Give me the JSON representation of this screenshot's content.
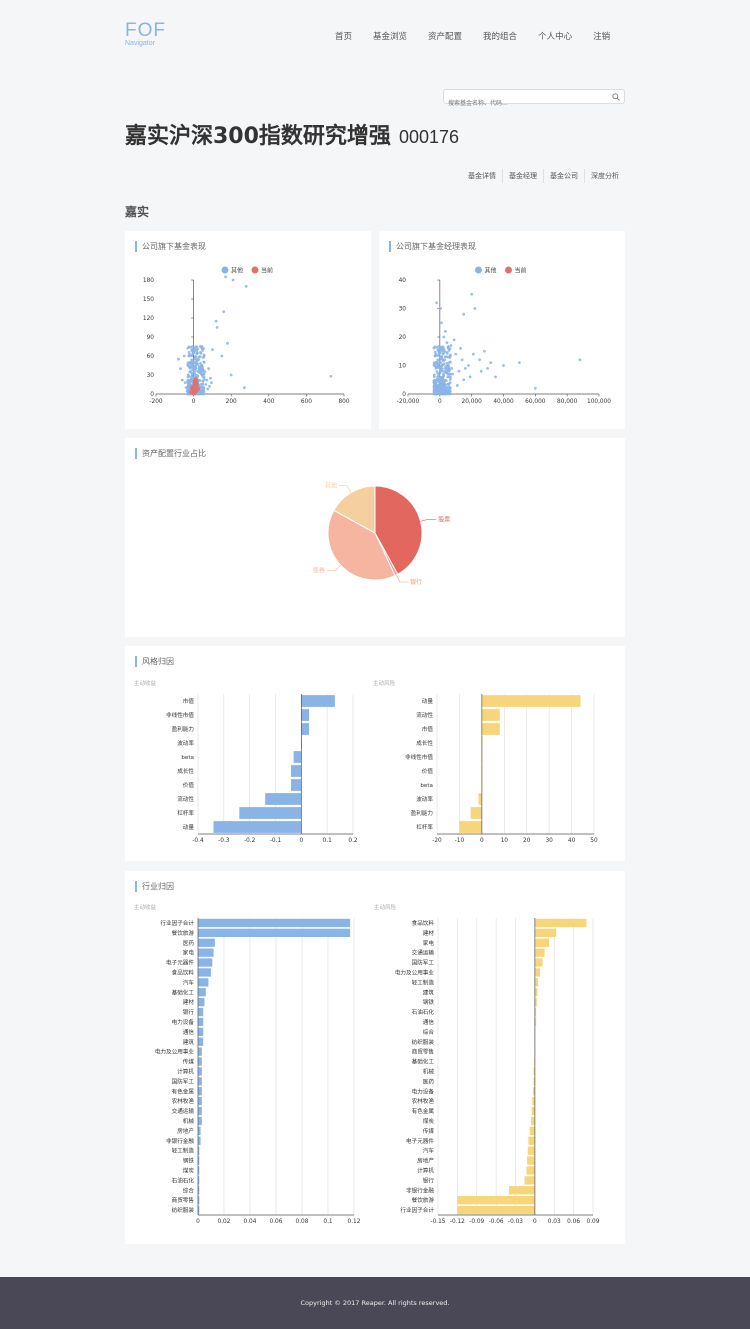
{
  "header": {
    "logo": "FOF",
    "logo_sub": "Navigator",
    "nav": [
      "首页",
      "基金浏览",
      "资产配置",
      "我的组合",
      "个人中心",
      "注销"
    ]
  },
  "search": {
    "placeholder": "搜索基金名称、代码..."
  },
  "fund": {
    "name": "嘉实沪深300指数研究增强",
    "code": "000176"
  },
  "subtabs": [
    "基金详情",
    "基金经理",
    "基金公司",
    "深度分析"
  ],
  "company": "嘉实",
  "cards": {
    "fund_perf": "公司旗下基金表现",
    "manager_perf": "公司旗下基金经理表现",
    "allocation": "资产配置行业占比",
    "style": "风格归因",
    "industry": "行业归因"
  },
  "legend": {
    "other": "其他",
    "current": "当前"
  },
  "sub_labels": {
    "income": "主动收益",
    "risk": "主动风险"
  },
  "colors": {
    "blue": "#8ab4e6",
    "red": "#e0716a",
    "yellow": "#f7d57a",
    "pie_stock": "#e2685f",
    "pie_bond": "#f5b5a1",
    "pie_other": "#f5cfa0",
    "pie_bank": "#ef9a84"
  },
  "chart_data": [
    {
      "type": "scatter",
      "title": "公司旗下基金表现",
      "xlim": [
        -200,
        800
      ],
      "ylim": [
        0,
        180
      ],
      "xticks": [
        -200,
        0,
        200,
        400,
        600,
        800
      ],
      "yticks": [
        0,
        30,
        60,
        90,
        120,
        150,
        180
      ],
      "series": [
        {
          "name": "其他",
          "points": [
            [
              -10,
              20
            ],
            [
              -5,
              15
            ],
            [
              0,
              10
            ],
            [
              5,
              25
            ],
            [
              10,
              30
            ],
            [
              15,
              20
            ],
            [
              20,
              18
            ],
            [
              -20,
              35
            ],
            [
              -25,
              28
            ],
            [
              30,
              12
            ],
            [
              40,
              40
            ],
            [
              -30,
              45
            ],
            [
              -15,
              50
            ],
            [
              25,
              55
            ],
            [
              60,
              35
            ],
            [
              80,
              40
            ],
            [
              100,
              70
            ],
            [
              120,
              115
            ],
            [
              125,
              105
            ],
            [
              160,
              130
            ],
            [
              170,
              185
            ],
            [
              210,
              180
            ],
            [
              280,
              170
            ],
            [
              200,
              30
            ],
            [
              270,
              10
            ],
            [
              730,
              28
            ],
            [
              150,
              60
            ],
            [
              180,
              80
            ],
            [
              -50,
              60
            ],
            [
              -70,
              40
            ],
            [
              -80,
              55
            ],
            [
              50,
              20
            ],
            [
              70,
              22
            ],
            [
              90,
              25
            ],
            [
              -40,
              10
            ],
            [
              -35,
              5
            ],
            [
              10,
              50
            ],
            [
              20,
              65
            ],
            [
              35,
              75
            ],
            [
              -5,
              38
            ],
            [
              0,
              45
            ],
            [
              5,
              33
            ],
            [
              12,
              42
            ],
            [
              18,
              48
            ],
            [
              22,
              28
            ],
            [
              -8,
              26
            ],
            [
              45,
              30
            ],
            [
              55,
              50
            ],
            [
              65,
              15
            ],
            [
              75,
              8
            ],
            [
              85,
              12
            ],
            [
              95,
              18
            ],
            [
              -60,
              22
            ],
            [
              -45,
              18
            ]
          ]
        },
        {
          "name": "当前",
          "points": [
            [
              0,
              8
            ],
            [
              5,
              12
            ],
            [
              10,
              5
            ],
            [
              -5,
              10
            ],
            [
              15,
              15
            ],
            [
              8,
              18
            ],
            [
              -10,
              3
            ],
            [
              20,
              8
            ],
            [
              3,
              2
            ],
            [
              12,
              22
            ]
          ]
        }
      ]
    },
    {
      "type": "scatter",
      "title": "公司旗下基金经理表现",
      "xlim": [
        -20000,
        100000
      ],
      "ylim": [
        0,
        40
      ],
      "xticks": [
        -20000,
        0,
        20000,
        40000,
        60000,
        80000,
        100000
      ],
      "yticks": [
        0,
        10,
        20,
        30,
        40
      ],
      "series": [
        {
          "name": "其他",
          "points": [
            [
              500,
              5
            ],
            [
              1000,
              8
            ],
            [
              2000,
              12
            ],
            [
              3000,
              15
            ],
            [
              1500,
              10
            ],
            [
              4000,
              9
            ],
            [
              5000,
              6
            ],
            [
              6000,
              11
            ],
            [
              8000,
              7
            ],
            [
              10000,
              14
            ],
            [
              12000,
              8
            ],
            [
              15000,
              5
            ],
            [
              18000,
              10
            ],
            [
              2500,
              20
            ],
            [
              1000,
              25
            ],
            [
              500,
              30
            ],
            [
              -2000,
              32
            ],
            [
              20000,
              35
            ],
            [
              22000,
              30
            ],
            [
              15000,
              28
            ],
            [
              25000,
              12
            ],
            [
              30000,
              9
            ],
            [
              40000,
              10
            ],
            [
              50000,
              11
            ],
            [
              60000,
              2
            ],
            [
              88000,
              12
            ],
            [
              35000,
              6
            ],
            [
              28000,
              15
            ],
            [
              7000,
              17
            ],
            [
              9000,
              19
            ],
            [
              3500,
              22
            ],
            [
              4500,
              18
            ],
            [
              1200,
              16
            ],
            [
              800,
              13
            ],
            [
              300,
              11
            ],
            [
              200,
              4
            ],
            [
              600,
              2
            ],
            [
              1800,
              3
            ],
            [
              2200,
              7
            ],
            [
              11000,
              3
            ],
            [
              14000,
              12
            ],
            [
              16000,
              9
            ],
            [
              19000,
              6
            ],
            [
              21000,
              14
            ],
            [
              26000,
              8
            ],
            [
              32000,
              11
            ],
            [
              13000,
              16
            ],
            [
              6500,
              4
            ],
            [
              5500,
              13
            ],
            [
              7500,
              9
            ]
          ]
        },
        {
          "name": "当前",
          "points": []
        }
      ]
    },
    {
      "type": "pie",
      "title": "资产配置行业占比",
      "slices": [
        {
          "label": "股票",
          "value": 42
        },
        {
          "label": "银行",
          "value": 1
        },
        {
          "label": "债券",
          "value": 40
        },
        {
          "label": "其他",
          "value": 17
        }
      ]
    },
    {
      "type": "bar",
      "title": "主动收益",
      "orientation": "horizontal",
      "categories": [
        "市值",
        "非线性市值",
        "盈利能力",
        "波动率",
        "beta",
        "成长性",
        "价值",
        "流动性",
        "杠杆率",
        "动量"
      ],
      "values": [
        0.13,
        0.03,
        0.03,
        0.0,
        -0.03,
        -0.04,
        -0.04,
        -0.14,
        -0.24,
        -0.34
      ],
      "xlim": [
        -0.4,
        0.2
      ],
      "xticks": [
        -0.4,
        -0.3,
        -0.2,
        -0.1,
        0,
        0.1,
        0.2
      ]
    },
    {
      "type": "bar",
      "title": "主动风险",
      "orientation": "horizontal",
      "categories": [
        "动量",
        "流动性",
        "市值",
        "成长性",
        "非线性市值",
        "价值",
        "beta",
        "波动率",
        "盈利能力",
        "杠杆率"
      ],
      "values": [
        44,
        8,
        8,
        0.3,
        0.3,
        0.3,
        0.3,
        -1.5,
        -5,
        -10
      ],
      "xlim": [
        -20,
        50
      ],
      "xticks": [
        -20,
        -10,
        0,
        10,
        20,
        30,
        40,
        50
      ]
    },
    {
      "type": "bar",
      "title": "主动收益",
      "orientation": "horizontal",
      "categories": [
        "行业因子合计",
        "餐饮旅游",
        "医药",
        "家电",
        "电子元器件",
        "食品饮料",
        "汽车",
        "基础化工",
        "建材",
        "银行",
        "电力设备",
        "通信",
        "建筑",
        "电力及公用事业",
        "传媒",
        "计算机",
        "国防军工",
        "有色金属",
        "农林牧渔",
        "交通运输",
        "机械",
        "房地产",
        "非银行金融",
        "轻工制造",
        "钢铁",
        "煤炭",
        "石油石化",
        "综合",
        "商贸零售",
        "纺织服装"
      ],
      "values": [
        0.117,
        0.117,
        0.013,
        0.012,
        0.011,
        0.01,
        0.008,
        0.006,
        0.005,
        0.004,
        0.004,
        0.004,
        0.004,
        0.003,
        0.003,
        0.003,
        0.003,
        0.003,
        0.003,
        0.003,
        0.003,
        0.002,
        0.002,
        0.001,
        0.001,
        0.001,
        0.001,
        0.001,
        0.001,
        0.001
      ],
      "xlim": [
        0,
        0.12
      ],
      "xticks": [
        0,
        0.02,
        0.04,
        0.06,
        0.08,
        0.1,
        0.12
      ]
    },
    {
      "type": "bar",
      "title": "主动风险",
      "orientation": "horizontal",
      "categories": [
        "食品饮料",
        "建材",
        "家电",
        "交通运输",
        "国防军工",
        "电力及公用事业",
        "轻工制造",
        "建筑",
        "钢铁",
        "石油石化",
        "通信",
        "综合",
        "纺织服装",
        "商贸零售",
        "基础化工",
        "机械",
        "医药",
        "电力设备",
        "农林牧渔",
        "有色金属",
        "煤炭",
        "传媒",
        "电子元器件",
        "汽车",
        "房地产",
        "计算机",
        "银行",
        "非银行金融",
        "餐饮旅游",
        "行业因子合计"
      ],
      "values": [
        0.08,
        0.033,
        0.022,
        0.015,
        0.012,
        0.008,
        0.005,
        0.004,
        0.003,
        0.002,
        0.002,
        0.001,
        0.0,
        0.0,
        -0.001,
        -0.002,
        -0.002,
        -0.003,
        -0.004,
        -0.005,
        -0.006,
        -0.008,
        -0.01,
        -0.011,
        -0.012,
        -0.013,
        -0.016,
        -0.04,
        -0.12,
        -0.12
      ],
      "xlim": [
        -0.15,
        0.09
      ],
      "xticks": [
        -0.15,
        -0.12,
        -0.09,
        -0.06,
        -0.03,
        0,
        0.03,
        0.06,
        0.09
      ]
    }
  ],
  "footer": "Copyright © 2017 Reaper. All rights reserved."
}
